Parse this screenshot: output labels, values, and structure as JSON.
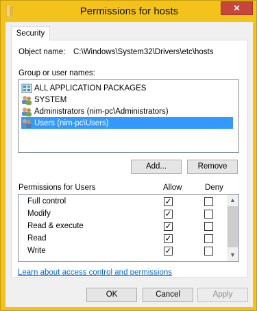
{
  "window": {
    "title": "Permissions for hosts",
    "close_glyph": "✕"
  },
  "tabs": [
    {
      "label": "Security",
      "active": true
    }
  ],
  "object": {
    "label": "Object name:",
    "value": "C:\\Windows\\System32\\Drivers\\etc\\hosts"
  },
  "groups": {
    "label": "Group or user names:",
    "items": [
      {
        "label": "ALL APPLICATION PACKAGES",
        "icon": "app-packages-icon",
        "selected": false
      },
      {
        "label": "SYSTEM",
        "icon": "users-icon",
        "selected": false
      },
      {
        "label": "Administrators (nim-pc\\Administrators)",
        "icon": "users-icon",
        "selected": false
      },
      {
        "label": "Users (nim-pc\\Users)",
        "icon": "users-icon",
        "selected": true
      }
    ],
    "add_label": "Add...",
    "remove_label": "Remove"
  },
  "permissions": {
    "label": "Permissions for Users",
    "allow_header": "Allow",
    "deny_header": "Deny",
    "rows": [
      {
        "name": "Full control",
        "allow": true,
        "deny": false
      },
      {
        "name": "Modify",
        "allow": true,
        "deny": false
      },
      {
        "name": "Read & execute",
        "allow": true,
        "deny": false
      },
      {
        "name": "Read",
        "allow": true,
        "deny": false
      },
      {
        "name": "Write",
        "allow": true,
        "deny": false
      }
    ]
  },
  "link": "Learn about access control and permissions",
  "footer": {
    "ok": "OK",
    "cancel": "Cancel",
    "apply": "Apply"
  },
  "colors": {
    "frame": "#f3c21b",
    "close": "#c7463a",
    "selection": "#3399ff",
    "link": "#0066cc"
  }
}
